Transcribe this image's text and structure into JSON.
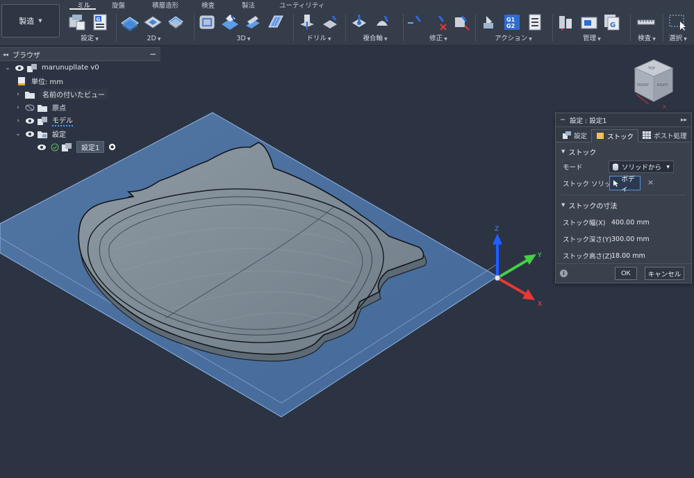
{
  "workspace": {
    "label": "製造"
  },
  "tabs": [
    {
      "label": "ミル",
      "active": true
    },
    {
      "label": "旋盤",
      "active": false
    },
    {
      "label": "積層造形",
      "active": false
    },
    {
      "label": "検査",
      "active": false
    },
    {
      "label": "製法",
      "active": false
    },
    {
      "label": "ユーティリティ",
      "active": false
    }
  ],
  "ribbon_groups": [
    {
      "label": "設定"
    },
    {
      "label": "2D"
    },
    {
      "label": "3D"
    },
    {
      "label": "ドリル"
    },
    {
      "label": "複合軸"
    },
    {
      "label": "修正"
    },
    {
      "label": "アクション"
    },
    {
      "label": "管理"
    },
    {
      "label": "検査"
    },
    {
      "label": "選択"
    }
  ],
  "ribbon_badges": {
    "g_small": "G",
    "g1": "G1",
    "g2": "G2",
    "g_manage": "G"
  },
  "browser": {
    "title": "ブラウザ",
    "items": [
      {
        "label": "marunupllate v0"
      },
      {
        "label": "単位: mm"
      },
      {
        "label": "名前の付いたビュー"
      },
      {
        "label": "原点"
      },
      {
        "label": "モデル"
      },
      {
        "label": "設定"
      },
      {
        "label": "設定1"
      }
    ]
  },
  "viewcube": {
    "top": "TOP",
    "front": "FRONT",
    "right": "RIGHT",
    "axis_label": "X"
  },
  "axes": {
    "x": "X",
    "y": "Y",
    "z": "Z"
  },
  "dialog": {
    "title": "設定 : 設定1",
    "tabs": [
      {
        "label": "設定",
        "active": false
      },
      {
        "label": "ストック",
        "active": true
      },
      {
        "label": "ポスト処理",
        "active": false
      }
    ],
    "stock_section": {
      "title": "ストック",
      "mode_label": "モード",
      "mode_value": "ソリッドから",
      "solid_label": "ストック ソリッド",
      "solid_value": "ボディ"
    },
    "dimensions_section": {
      "title": "ストックの寸法",
      "rows": [
        {
          "label": "ストック幅(X)",
          "value": "400.00 mm"
        },
        {
          "label": "ストック深さ(Y)",
          "value": "300.00 mm"
        },
        {
          "label": "ストック高さ(Z)",
          "value": "18.00 mm"
        }
      ]
    },
    "ok_label": "OK",
    "cancel_label": "キャンセル"
  },
  "colors": {
    "background": "#2c3342",
    "stock_blue": "#6b9bd1",
    "axis_x": "#e53935",
    "axis_y": "#43d047",
    "axis_z": "#1f5fff"
  }
}
